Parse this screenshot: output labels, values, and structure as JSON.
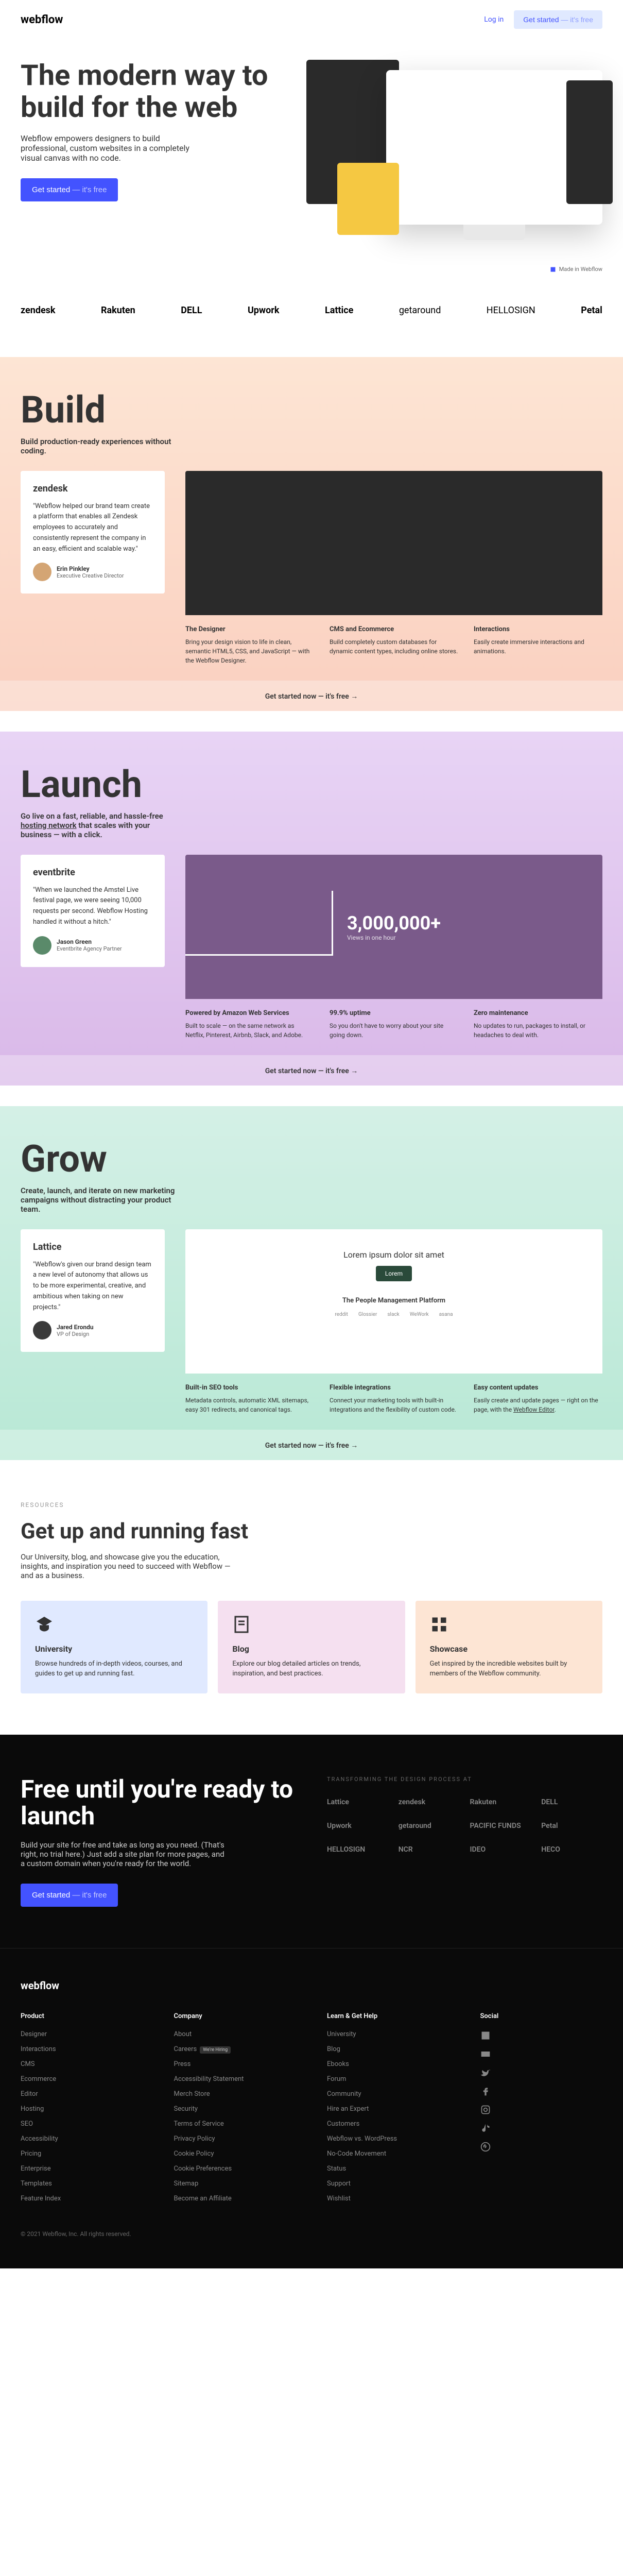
{
  "header": {
    "logo": "webflow",
    "login": "Log in",
    "cta": "Get started",
    "cta_suffix": " — it's free"
  },
  "hero": {
    "title": "The modern way to build for the web",
    "subtitle": "Webflow empowers designers to build professional, custom websites in a completely visual canvas with no code.",
    "cta": "Get started",
    "cta_suffix": " — it's free"
  },
  "made_in": "Made in Webflow",
  "brand_logos": [
    "zendesk",
    "Rakuten",
    "DELL",
    "Upwork",
    "Lattice",
    "getaround",
    "HELLOSIGN",
    "Petal"
  ],
  "build": {
    "title": "Build",
    "subtitle": "Build production-ready experiences without coding.",
    "testimonial": {
      "logo": "zendesk",
      "quote": "\"Webflow helped our brand team create a platform that enables all Zendesk employees to accurately and consistently represent the company in an easy, efficient and scalable way.\"",
      "name": "Erin Pinkley",
      "role": "Executive Creative Director"
    },
    "features": [
      {
        "title": "The Designer",
        "desc": "Bring your design vision to life in clean, semantic HTML5, CSS, and JavaScript — with the Webflow Designer."
      },
      {
        "title": "CMS and Ecommerce",
        "desc": "Build completely custom databases for dynamic content types, including online stores."
      },
      {
        "title": "Interactions",
        "desc": "Easily create immersive interactions and animations."
      }
    ]
  },
  "launch": {
    "title": "Launch",
    "subtitle_pre": "Go live on a fast, reliable, and hassle-free ",
    "subtitle_link": "hosting network",
    "subtitle_post": " that scales with your business — with a click.",
    "stat": "3,000,000+",
    "stat_sub": "Views in one hour",
    "testimonial": {
      "logo": "eventbrite",
      "quote": "\"When we launched the Amstel Live festival page, we were seeing 10,000 requests per second. Webflow Hosting handled it without a hitch.\"",
      "name": "Jason Green",
      "role": "Eventbrite Agency Partner"
    },
    "features": [
      {
        "title": "Powered by Amazon Web Services",
        "desc": "Built to scale — on the same network as Netflix, Pinterest, Airbnb, Slack, and Adobe."
      },
      {
        "title": "99.9% uptime",
        "desc": "So you don't have to worry about your site going down."
      },
      {
        "title": "Zero maintenance",
        "desc": "No updates to run, packages to install, or headaches to deal with."
      }
    ]
  },
  "grow": {
    "title": "Grow",
    "subtitle": "Create, launch, and iterate on new marketing campaigns without distracting your product team.",
    "preview": {
      "lorem": "Lorem ipsum dolor sit amet",
      "btn": "Lorem",
      "sub": "The People Management Platform",
      "logos": [
        "reddit",
        "Glossier",
        "slack",
        "WeWork",
        "asana"
      ]
    },
    "testimonial": {
      "logo": "Lattice",
      "quote": "\"Webflow's given our brand design team a new level of autonomy that allows us to be more experimental, creative, and ambitious when taking on new projects.\"",
      "name": "Jared Erondu",
      "role": "VP of Design"
    },
    "features": [
      {
        "title": "Built-in SEO tools",
        "desc": "Metadata controls, automatic XML sitemaps, easy 301 redirects, and canonical tags."
      },
      {
        "title": "Flexible integrations",
        "desc": "Connect your marketing tools with built-in integrations and the flexibility of custom code."
      },
      {
        "title": "Easy content updates",
        "desc_pre": "Easily create and update pages — right on the page, with the ",
        "desc_link": "Webflow Editor",
        "desc_post": "."
      }
    ]
  },
  "section_cta": "Get started now — it's free  →",
  "resources": {
    "label": "RESOURCES",
    "title": "Get up and running fast",
    "subtitle": "Our University, blog, and showcase give you the education, insights, and inspiration you need to succeed with Webflow — and as a business.",
    "cards": [
      {
        "title": "University",
        "desc": "Browse hundreds of in-depth videos, courses, and guides to get up and running fast."
      },
      {
        "title": "Blog",
        "desc": "Explore our blog detailed articles on trends, inspiration, and best practices."
      },
      {
        "title": "Showcase",
        "desc": "Get inspired by the incredible websites built by members of the Webflow community."
      }
    ]
  },
  "dark": {
    "title": "Free until you're ready to launch",
    "subtitle": "Build your site for free and take as long as you need. (That's right, no trial here.) Just add a site plan for more pages, and a custom domain when you're ready for the world.",
    "cta": "Get started",
    "cta_suffix": " — it's free",
    "label": "TRANSFORMING THE DESIGN PROCESS AT",
    "logos": [
      "Lattice",
      "zendesk",
      "Rakuten",
      "DELL",
      "Upwork",
      "getaround",
      "PACIFIC FUNDS",
      "Petal",
      "HELLOSIGN",
      "NCR",
      "IDEO",
      "HECO"
    ]
  },
  "footer": {
    "logo": "webflow",
    "cols": [
      {
        "title": "Product",
        "links": [
          "Designer",
          "Interactions",
          "CMS",
          "Ecommerce",
          "Editor",
          "Hosting",
          "SEO",
          "Accessibility",
          "Pricing",
          "Enterprise",
          "Templates",
          "Feature Index"
        ]
      },
      {
        "title": "Company",
        "links": [
          "About",
          "Careers",
          "Press",
          "Accessibility Statement",
          "Merch Store",
          "Security",
          "Terms of Service",
          "Privacy Policy",
          "Cookie Policy",
          "Cookie Preferences",
          "Sitemap",
          "Become an Affiliate"
        ],
        "badge_idx": 1,
        "badge": "We're Hiring"
      },
      {
        "title": "Learn & Get Help",
        "links": [
          "University",
          "Blog",
          "Ebooks",
          "Forum",
          "Community",
          "Hire an Expert",
          "Customers",
          "Webflow vs. WordPress",
          "No-Code Movement",
          "Status",
          "Support",
          "Wishlist"
        ]
      }
    ],
    "social_title": "Social",
    "copyright": "© 2021 Webflow, Inc. All rights reserved."
  }
}
